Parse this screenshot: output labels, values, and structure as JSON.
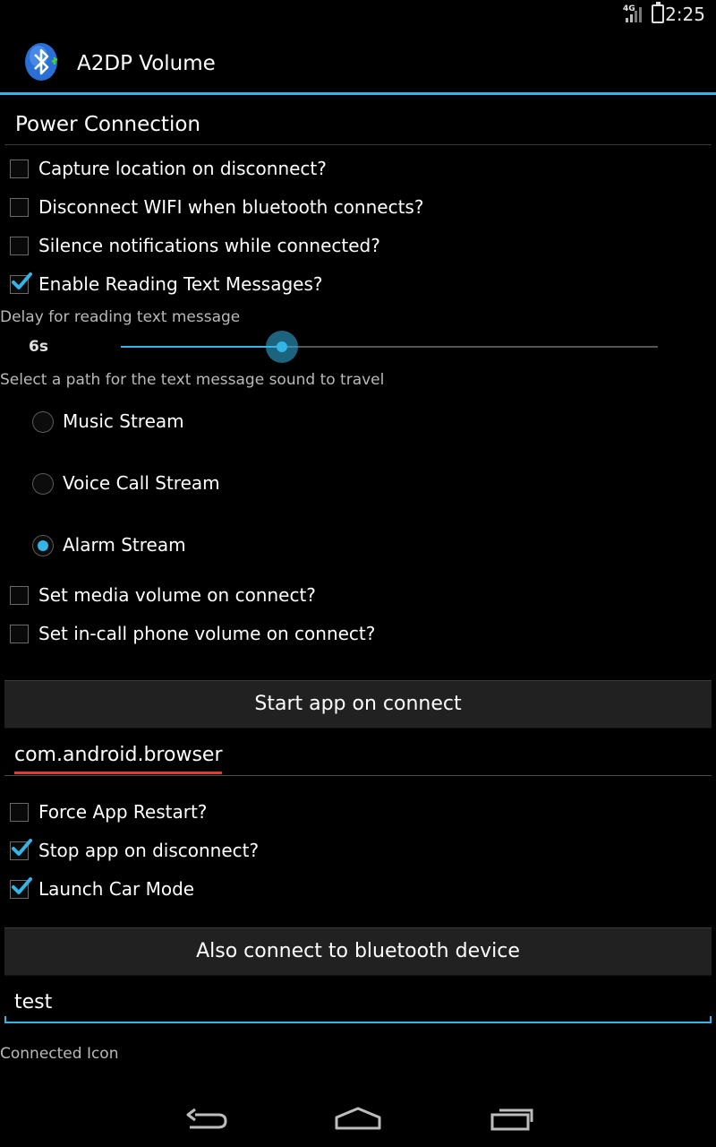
{
  "status_bar": {
    "time": "2:25",
    "network": "4G",
    "icons": [
      "signal-icon",
      "battery-icon"
    ]
  },
  "action_bar": {
    "title": "A2DP Volume",
    "icon": "bluetooth-icon"
  },
  "power_connection": {
    "category_title": "Power Connection",
    "capture_location": {
      "label": "Capture location on disconnect?",
      "checked": false
    },
    "disconnect_wifi": {
      "label": "Disconnect WIFI when bluetooth connects?",
      "checked": false
    },
    "silence_notifications": {
      "label": "Silence notifications while connected?",
      "checked": false
    },
    "enable_reading": {
      "label": "Enable Reading Text Messages?",
      "checked": true
    },
    "delay_label": "Delay for reading text message",
    "delay_value": "6s",
    "delay_fraction": 0.3,
    "path_label": "Select a path for the text message sound to travel",
    "streams": [
      {
        "label": "Music Stream",
        "checked": false
      },
      {
        "label": "Voice Call Stream",
        "checked": false
      },
      {
        "label": "Alarm Stream",
        "checked": true
      }
    ],
    "set_media_volume": {
      "label": "Set media volume on connect?",
      "checked": false
    },
    "set_incall_volume": {
      "label": "Set in-call phone volume on connect?",
      "checked": false
    }
  },
  "start_app": {
    "button_label": "Start app on connect",
    "app_value": "com.android.browser",
    "force_restart": {
      "label": "Force App Restart?",
      "checked": false
    },
    "stop_app": {
      "label": "Stop app on disconnect?",
      "checked": true
    },
    "car_mode": {
      "label": "Launch Car Mode",
      "checked": true
    }
  },
  "bt_connect": {
    "button_label": "Also connect to bluetooth device",
    "device_value": "test",
    "connected_icon_label": "Connected Icon"
  },
  "colors": {
    "accent": "#33b5e5",
    "background": "#000000",
    "button": "#212121",
    "spellcheck": "#e53935"
  }
}
